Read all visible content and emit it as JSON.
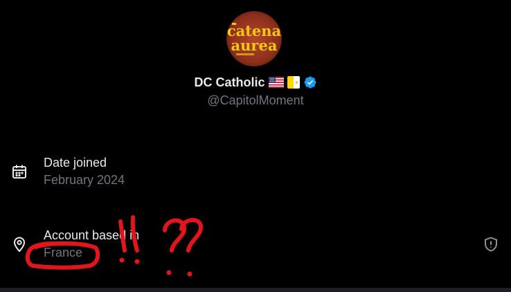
{
  "profile": {
    "display_name": "DC Catholic",
    "handle": "@CapitolMoment",
    "verified": true,
    "flags": [
      "us-flag",
      "vatican-flag"
    ],
    "avatar": {
      "line1": "catena",
      "line2": "aurea"
    }
  },
  "details": {
    "date_joined": {
      "label": "Date joined",
      "value": "February 2024",
      "icon": "calendar-icon"
    },
    "account_location": {
      "label": "Account based in",
      "value": "France",
      "icon": "location-pin-icon",
      "trailing_icon": "shield-alert-icon"
    }
  },
  "colors": {
    "background": "#000000",
    "primary_text": "#e7e9ea",
    "secondary_text": "#71767b",
    "verified_blue": "#1d9bf0",
    "annotation_red": "#e0161c"
  }
}
